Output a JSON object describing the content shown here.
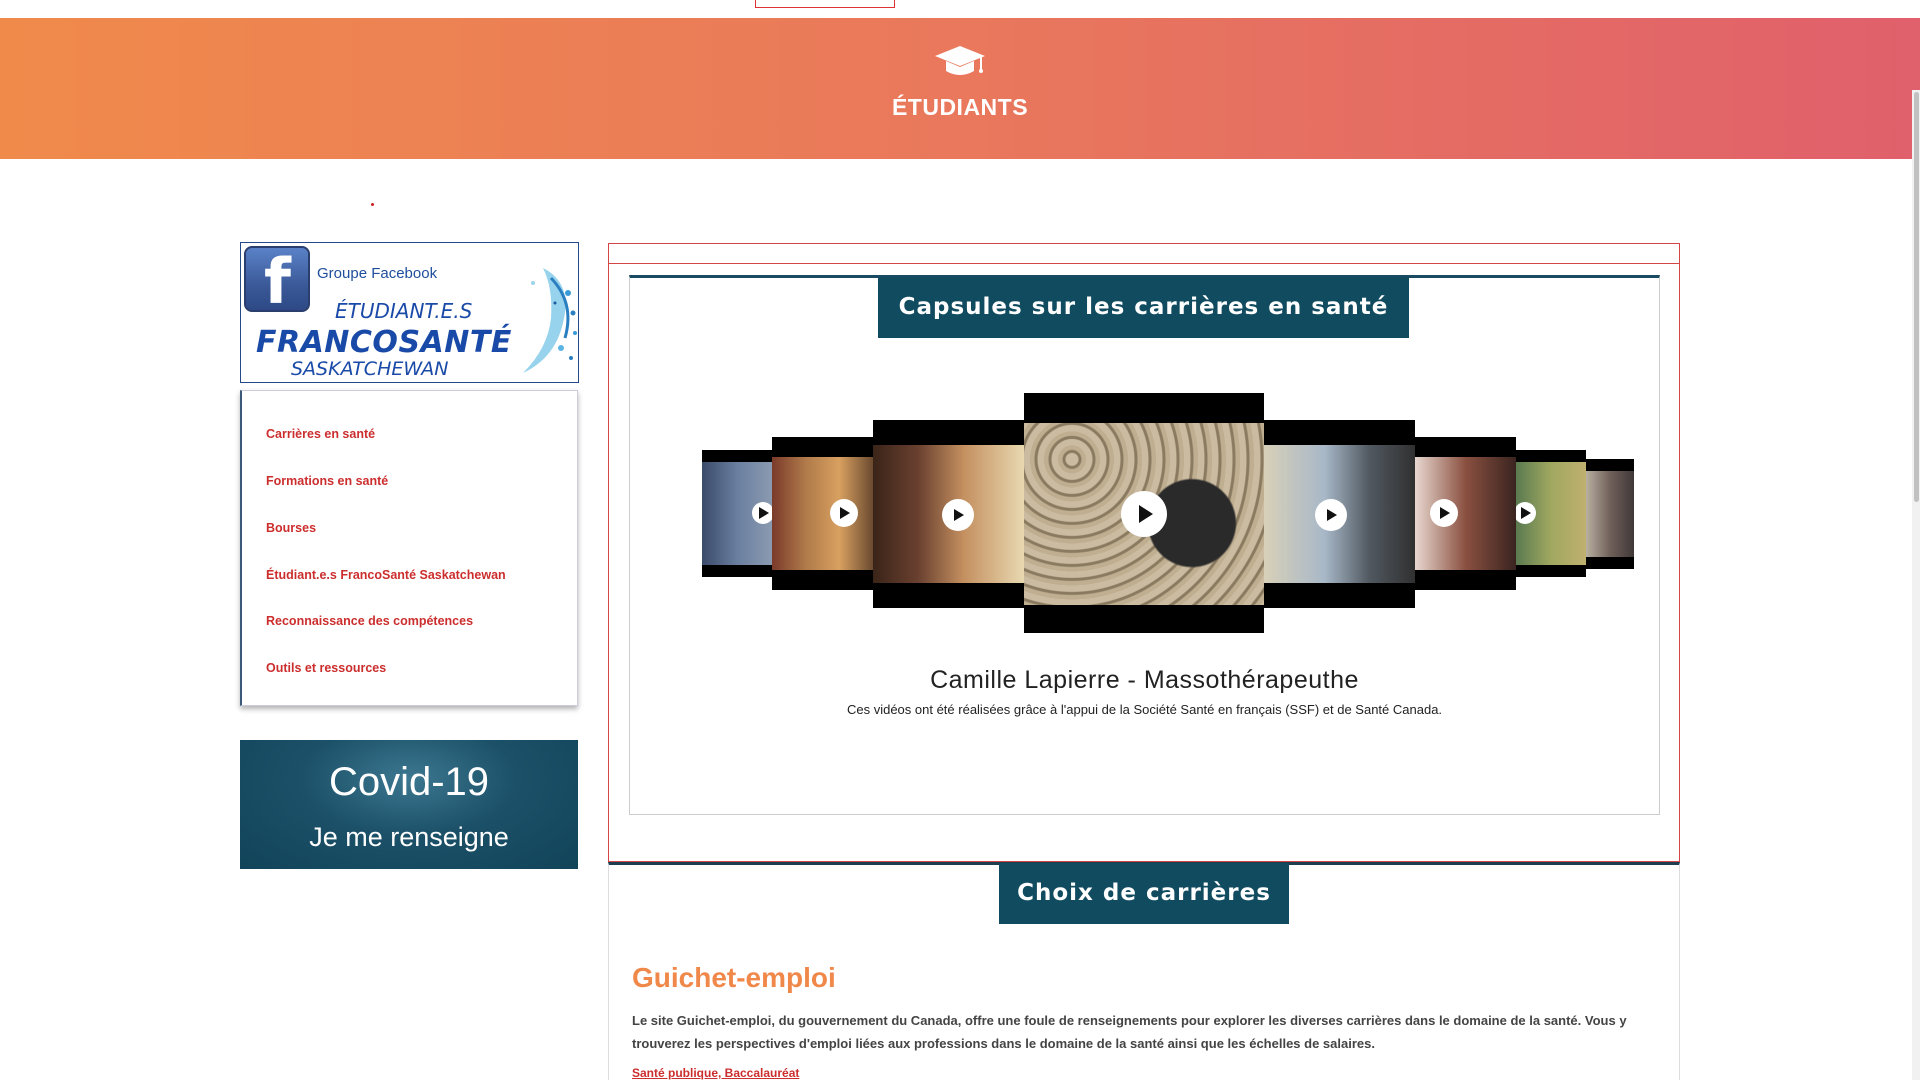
{
  "hero": {
    "title": "ÉTUDIANTS",
    "icon": "graduation-cap-icon"
  },
  "facebook_banner": {
    "group_label": "Groupe Facebook",
    "line1": "ÉTUDIANT.E.S",
    "line2": "FRANCOSANTÉ",
    "line3": "SASKATCHEWAN"
  },
  "sidebar": {
    "items": [
      {
        "label": "Carrières en santé"
      },
      {
        "label": "Formations en santé"
      },
      {
        "label": "Bourses"
      },
      {
        "label": "Étudiant.e.s FrancoSanté Saskatchewan"
      },
      {
        "label": "Reconnaissance des compétences"
      },
      {
        "label": "Outils et ressources"
      }
    ]
  },
  "covid": {
    "title": "Covid-19",
    "subtitle": "Je me renseigne"
  },
  "capsules": {
    "heading": "Capsules sur les carrières en santé",
    "video_title": "Camille Lapierre - Massothérapeuthe",
    "credit": "Ces vidéos ont été réalisées grâce à l'appui de la Société Santé en français (SSF) et de Santé Canada."
  },
  "careers": {
    "heading": "Choix de carrières",
    "guichet_title": "Guichet-emploi",
    "guichet_text": "Le site Guichet-emploi, du gouvernement du Canada, offre une foule de renseignements pour explorer les diverses carrières dans le domaine de la santé. Vous y trouverez les perspectives d'emploi liées aux professions dans le domaine de la santé ainsi que les échelles de salaires.",
    "guichet_link": "Santé publique, Baccalauréat"
  },
  "colors": {
    "accent": "#114b5f",
    "link": "#cc2e2e",
    "orange": "#f0884a"
  }
}
